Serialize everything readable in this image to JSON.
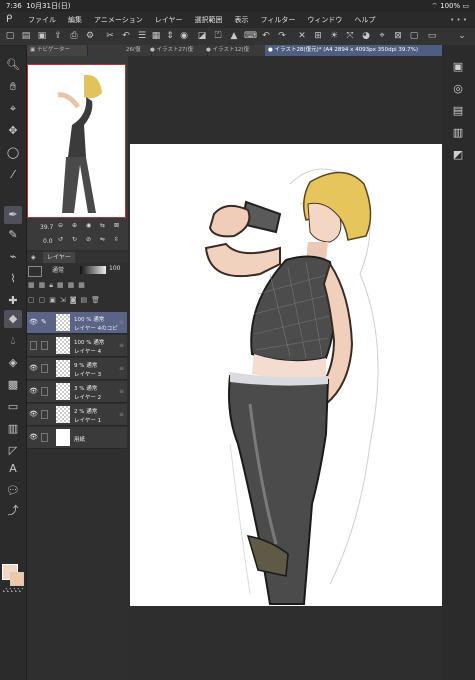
{
  "status": {
    "time": "7:36",
    "date": "10月31日(日)",
    "wifi": "wifi-icon",
    "battery": "100%"
  },
  "menu": {
    "items": [
      "ファイル",
      "編集",
      "アニメーション",
      "レイヤー",
      "選択範囲",
      "表示",
      "フィルター",
      "ウィンドウ",
      "ヘルプ"
    ]
  },
  "tabs": [
    {
      "label": "26(復"
    },
    {
      "label": "● イラスト27(復"
    },
    {
      "label": "● イラスト12(復"
    },
    {
      "label": "● イラスト28(復元)* (A4 2894 x 4093px 350dpi 39.7%)"
    }
  ],
  "navigator": {
    "title": "ナビゲーター",
    "zoom": "39.7",
    "rotation": "0.0"
  },
  "layers": {
    "title": "レイヤー",
    "blend": "通常",
    "opacity": "100",
    "rows": [
      {
        "opacity": "100 % 通常",
        "name": "レイヤー 4のコピ",
        "visible": true,
        "selected": true
      },
      {
        "opacity": "100 % 通常",
        "name": "レイヤー 4",
        "visible": false,
        "selected": false
      },
      {
        "opacity": "9 % 通常",
        "name": "レイヤー 3",
        "visible": true,
        "selected": false
      },
      {
        "opacity": "3 % 通常",
        "name": "レイヤー 2",
        "visible": true,
        "selected": false
      },
      {
        "opacity": "2 % 通常",
        "name": "レイヤー 1",
        "visible": true,
        "selected": false
      },
      {
        "opacity": "",
        "name": "用紙",
        "visible": true,
        "selected": false
      }
    ]
  },
  "colors": {
    "main": "#f4d6c2",
    "sub": "#f0c8a8",
    "panel_bg": "#2f2f2f",
    "selected_layer": "#5a6487",
    "active_tab": "#4e5e80"
  }
}
